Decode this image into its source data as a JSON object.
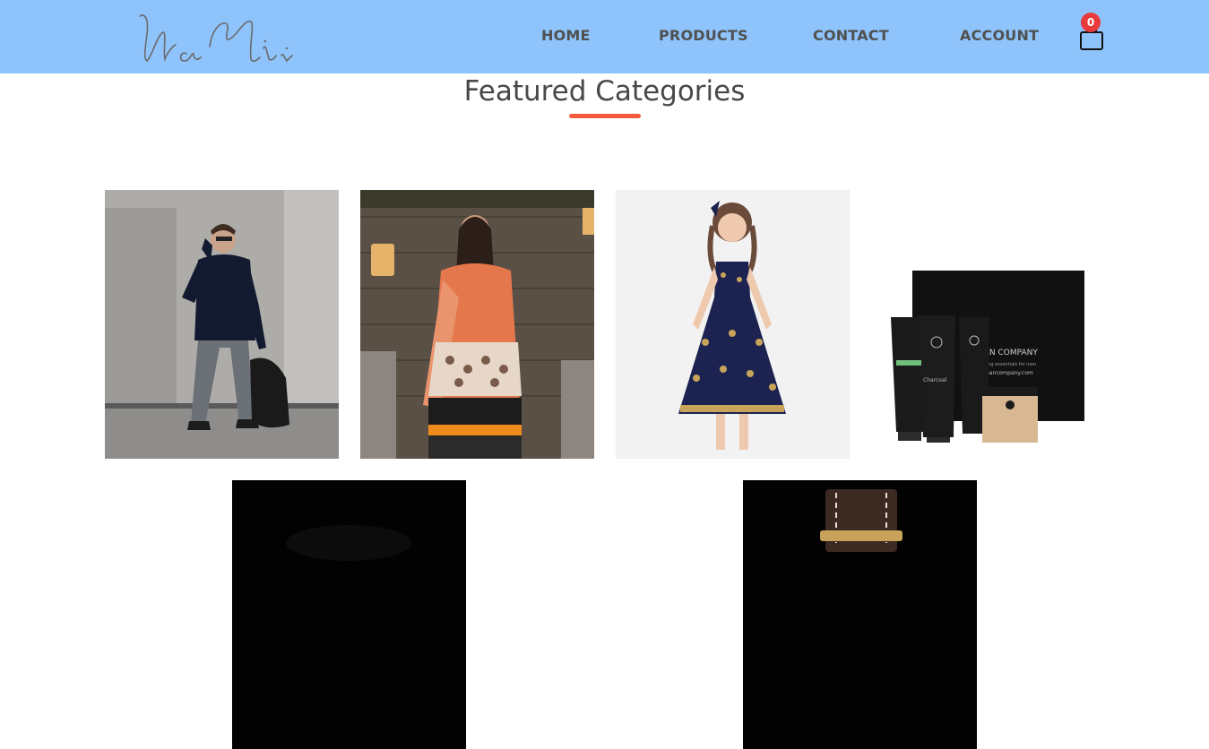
{
  "brand": {
    "logo_text": "NaMi"
  },
  "nav": {
    "items": [
      {
        "label": "HOME"
      },
      {
        "label": "PRODUCTS"
      },
      {
        "label": "CONTACT"
      },
      {
        "label": "ACCOUNT"
      }
    ],
    "cart_count": "0",
    "cart_icon": "shopping-bag-icon"
  },
  "featured": {
    "title": "Featured Categories",
    "accent_color": "#f15a3e",
    "categories": [
      {
        "name": "men-category",
        "image_alt": "Man in navy sweater walking with backpack"
      },
      {
        "name": "women-category",
        "image_alt": "Woman in orange printed kurta with dupatta"
      },
      {
        "name": "kids-category",
        "image_alt": "Girl in navy printed dress"
      },
      {
        "name": "grooming-category",
        "image_alt": "Grooming kit box with tubes"
      },
      {
        "name": "dark-category-1",
        "image_alt": "Dark product image"
      },
      {
        "name": "watch-category",
        "image_alt": "Leather watch strap"
      }
    ],
    "grooming_box_text": {
      "brand_line": "MAN COMPANY",
      "sub_line": "ming essentials for men",
      "url_line": "mancompany.com",
      "tube_label": "Charcoal"
    }
  },
  "colors": {
    "navbar_bg": "#8ec3fb",
    "nav_text": "#505050",
    "badge": "#e93b3b",
    "title_text": "#484848"
  }
}
